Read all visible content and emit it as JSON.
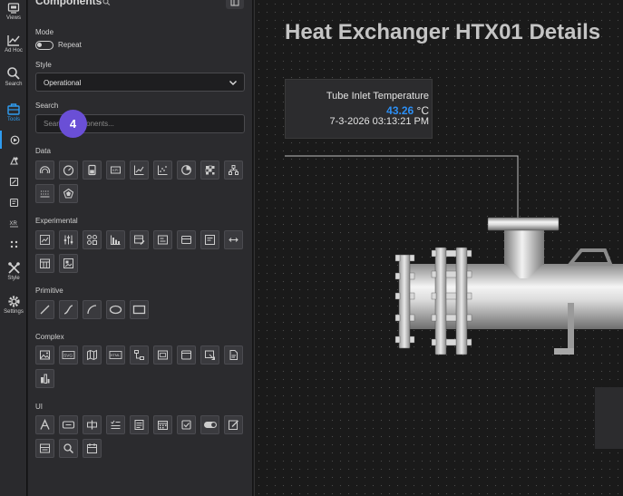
{
  "rail": {
    "items": [
      {
        "label": "Views",
        "icon": "views-icon"
      },
      {
        "label": "Ad Hoc",
        "icon": "adhoc-chart-icon"
      },
      {
        "label": "Search",
        "icon": "search-icon"
      },
      {
        "label": "Tools",
        "icon": "toolbox-icon"
      },
      {
        "label": "Style",
        "icon": "style-icon"
      },
      {
        "label": "Settings",
        "icon": "gear-icon"
      }
    ],
    "active_color": "#2f9cf0"
  },
  "panel": {
    "title": "Components",
    "mode_label": "Mode",
    "mode_toggle_label": "Repeat",
    "style_label": "Style",
    "style_value": "Operational",
    "search_label": "Search",
    "search_placeholder": "Search components...",
    "step_badge": "4",
    "sections": {
      "data": "Data",
      "experimental": "Experimental",
      "primitive": "Primitive",
      "complex": "Complex",
      "ui": "UI"
    },
    "complex_tile_labels": {
      "svg": "SVG",
      "html": "HTML"
    }
  },
  "canvas": {
    "title": "Heat Exchanger HTX01 Details",
    "readout": {
      "label": "Tube Inlet Temperature",
      "value": "43.26",
      "unit": "°C",
      "timestamp": "7-3-2026 03:13:21 PM",
      "value_color": "#2c8ff5"
    }
  }
}
